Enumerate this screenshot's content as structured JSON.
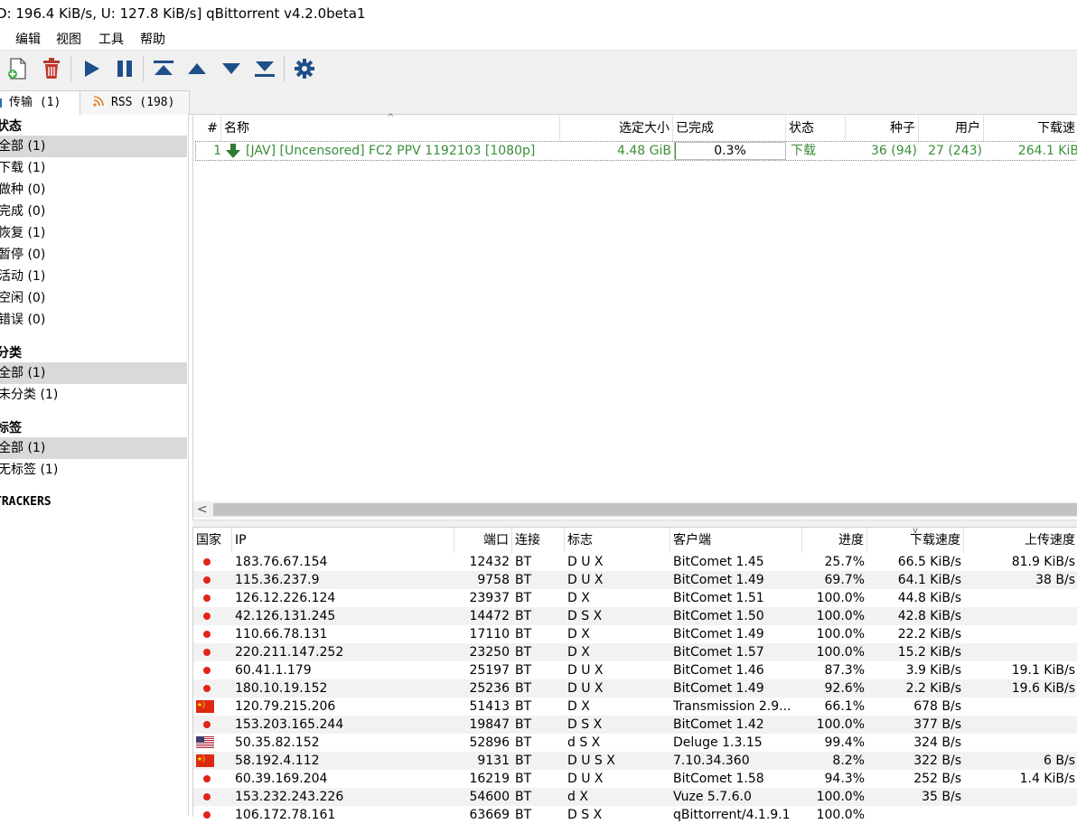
{
  "window": {
    "title": "D: 196.4 KiB/s, U: 127.8 KiB/s] qBittorrent v4.2.0beta1"
  },
  "menu": [
    "编辑",
    "视图",
    "工具",
    "帮助"
  ],
  "toolbar_icons": [
    "add-torrent-file-icon",
    "delete-icon",
    "resume-icon",
    "pause-icon",
    "move-top-icon",
    "move-up-icon",
    "move-down-icon",
    "move-bottom-icon",
    "options-gear-icon"
  ],
  "tabs": [
    {
      "label": "传输 (1)",
      "active": true
    },
    {
      "label": "RSS (198)",
      "active": false
    }
  ],
  "sidebar": {
    "status_heading": "状态",
    "status_items": [
      "全部 (1)",
      "下载 (1)",
      "做种 (0)",
      "完成 (0)",
      "恢复 (1)",
      "暂停 (0)",
      "活动 (1)",
      "空闲 (0)",
      "错误 (0)"
    ],
    "category_heading": "分类",
    "category_items": [
      "全部 (1)",
      "未分类 (1)"
    ],
    "tag_heading": "标签",
    "tag_items": [
      "全部 (1)",
      "无标签 (1)"
    ],
    "trackers_heading": "TRACKERS"
  },
  "torrent_list": {
    "headers": [
      "#",
      "名称",
      "选定大小",
      "已完成",
      "状态",
      "种子",
      "用户",
      "下载速"
    ],
    "rows": [
      {
        "num": "1",
        "name": "[JAV] [Uncensored] FC2 PPV 1192103 [1080p]",
        "size": "4.48 GiB",
        "done": "0.3%",
        "progress": 0.003,
        "status": "下载",
        "seeds": "36 (94)",
        "peers": "27 (243)",
        "dl": "264.1 KiB"
      }
    ]
  },
  "peers": {
    "headers": [
      "国家",
      "IP",
      "端口",
      "连接",
      "标志",
      "客户端",
      "进度",
      "下载速度",
      "上传速度"
    ],
    "rows": [
      {
        "flag": "dot",
        "ip": "183.76.67.154",
        "port": "12432",
        "conn": "BT",
        "flags": "D U X",
        "client": "BitComet 1.45",
        "progress": "25.7%",
        "dl": "66.5 KiB/s",
        "ul": "81.9 KiB/s"
      },
      {
        "flag": "dot",
        "ip": "115.36.237.9",
        "port": "9758",
        "conn": "BT",
        "flags": "D U X",
        "client": "BitComet 1.49",
        "progress": "69.7%",
        "dl": "64.1 KiB/s",
        "ul": "38 B/s"
      },
      {
        "flag": "dot",
        "ip": "126.12.226.124",
        "port": "23937",
        "conn": "BT",
        "flags": "D X",
        "client": "BitComet 1.51",
        "progress": "100.0%",
        "dl": "44.8 KiB/s",
        "ul": ""
      },
      {
        "flag": "dot",
        "ip": "42.126.131.245",
        "port": "14472",
        "conn": "BT",
        "flags": "D S X",
        "client": "BitComet 1.50",
        "progress": "100.0%",
        "dl": "42.8 KiB/s",
        "ul": ""
      },
      {
        "flag": "dot",
        "ip": "110.66.78.131",
        "port": "17110",
        "conn": "BT",
        "flags": "D X",
        "client": "BitComet 1.49",
        "progress": "100.0%",
        "dl": "22.2 KiB/s",
        "ul": ""
      },
      {
        "flag": "dot",
        "ip": "220.211.147.252",
        "port": "23250",
        "conn": "BT",
        "flags": "D X",
        "client": "BitComet 1.57",
        "progress": "100.0%",
        "dl": "15.2 KiB/s",
        "ul": ""
      },
      {
        "flag": "dot",
        "ip": "60.41.1.179",
        "port": "25197",
        "conn": "BT",
        "flags": "D U X",
        "client": "BitComet 1.46",
        "progress": "87.3%",
        "dl": "3.9 KiB/s",
        "ul": "19.1 KiB/s"
      },
      {
        "flag": "dot",
        "ip": "180.10.19.152",
        "port": "25236",
        "conn": "BT",
        "flags": "D U X",
        "client": "BitComet 1.49",
        "progress": "92.6%",
        "dl": "2.2 KiB/s",
        "ul": "19.6 KiB/s"
      },
      {
        "flag": "cn",
        "ip": "120.79.215.206",
        "port": "51413",
        "conn": "BT",
        "flags": "D X",
        "client": "Transmission 2.9...",
        "progress": "66.1%",
        "dl": "678 B/s",
        "ul": ""
      },
      {
        "flag": "dot",
        "ip": "153.203.165.244",
        "port": "19847",
        "conn": "BT",
        "flags": "D S X",
        "client": "BitComet 1.42",
        "progress": "100.0%",
        "dl": "377 B/s",
        "ul": ""
      },
      {
        "flag": "us",
        "ip": "50.35.82.152",
        "port": "52896",
        "conn": "BT",
        "flags": "d S X",
        "client": "Deluge 1.3.15",
        "progress": "99.4%",
        "dl": "324 B/s",
        "ul": ""
      },
      {
        "flag": "cn",
        "ip": "58.192.4.112",
        "port": "9131",
        "conn": "BT",
        "flags": "D U S X",
        "client": "7.10.34.360",
        "progress": "8.2%",
        "dl": "322 B/s",
        "ul": "6 B/s"
      },
      {
        "flag": "dot",
        "ip": "60.39.169.204",
        "port": "16219",
        "conn": "BT",
        "flags": "D U X",
        "client": "BitComet 1.58",
        "progress": "94.3%",
        "dl": "252 B/s",
        "ul": "1.4 KiB/s"
      },
      {
        "flag": "dot",
        "ip": "153.232.243.226",
        "port": "54600",
        "conn": "BT",
        "flags": "d X",
        "client": "Vuze 5.7.6.0",
        "progress": "100.0%",
        "dl": "35 B/s",
        "ul": ""
      },
      {
        "flag": "dot",
        "ip": "106.172.78.161",
        "port": "63669",
        "conn": "BT",
        "flags": "D S X",
        "client": "qBittorrent/4.1.9.1",
        "progress": "100.0%",
        "dl": "",
        "ul": ""
      }
    ]
  }
}
